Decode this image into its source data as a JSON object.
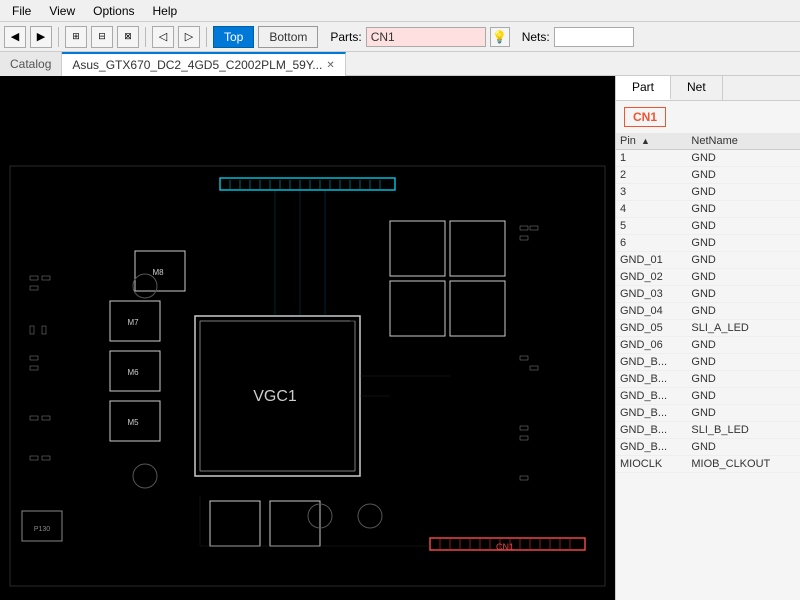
{
  "menubar": {
    "items": [
      "File",
      "View",
      "Options",
      "Help"
    ]
  },
  "toolbar": {
    "view_top_label": "Top",
    "view_bottom_label": "Bottom",
    "parts_label": "Parts:",
    "parts_value": "CN1",
    "nets_label": "Nets:",
    "nets_value": ""
  },
  "tabs": {
    "catalog_label": "Catalog",
    "active_label": "Asus_GTX670_DC2_4GD5_C2002PLM_59Y...",
    "close_symbol": "✕"
  },
  "panel": {
    "part_tab": "Part",
    "net_tab": "Net",
    "part_name": "CN1",
    "table_headers": [
      "Pin",
      "NetName"
    ],
    "sort_arrow": "▲",
    "rows": [
      {
        "pin": "1",
        "net": "GND"
      },
      {
        "pin": "2",
        "net": "GND"
      },
      {
        "pin": "3",
        "net": "GND"
      },
      {
        "pin": "4",
        "net": "GND"
      },
      {
        "pin": "5",
        "net": "GND"
      },
      {
        "pin": "6",
        "net": "GND"
      },
      {
        "pin": "GND_01",
        "net": "GND"
      },
      {
        "pin": "GND_02",
        "net": "GND"
      },
      {
        "pin": "GND_03",
        "net": "GND"
      },
      {
        "pin": "GND_04",
        "net": "GND"
      },
      {
        "pin": "GND_05",
        "net": "SLI_A_LED"
      },
      {
        "pin": "GND_06",
        "net": "GND"
      },
      {
        "pin": "GND_B...",
        "net": "GND"
      },
      {
        "pin": "GND_B...",
        "net": "GND"
      },
      {
        "pin": "GND_B...",
        "net": "GND"
      },
      {
        "pin": "GND_B...",
        "net": "GND"
      },
      {
        "pin": "GND_B...",
        "net": "SLI_B_LED"
      },
      {
        "pin": "GND_B...",
        "net": "GND"
      },
      {
        "pin": "MIOCLK",
        "net": "MIOB_CLKOUT"
      }
    ]
  }
}
